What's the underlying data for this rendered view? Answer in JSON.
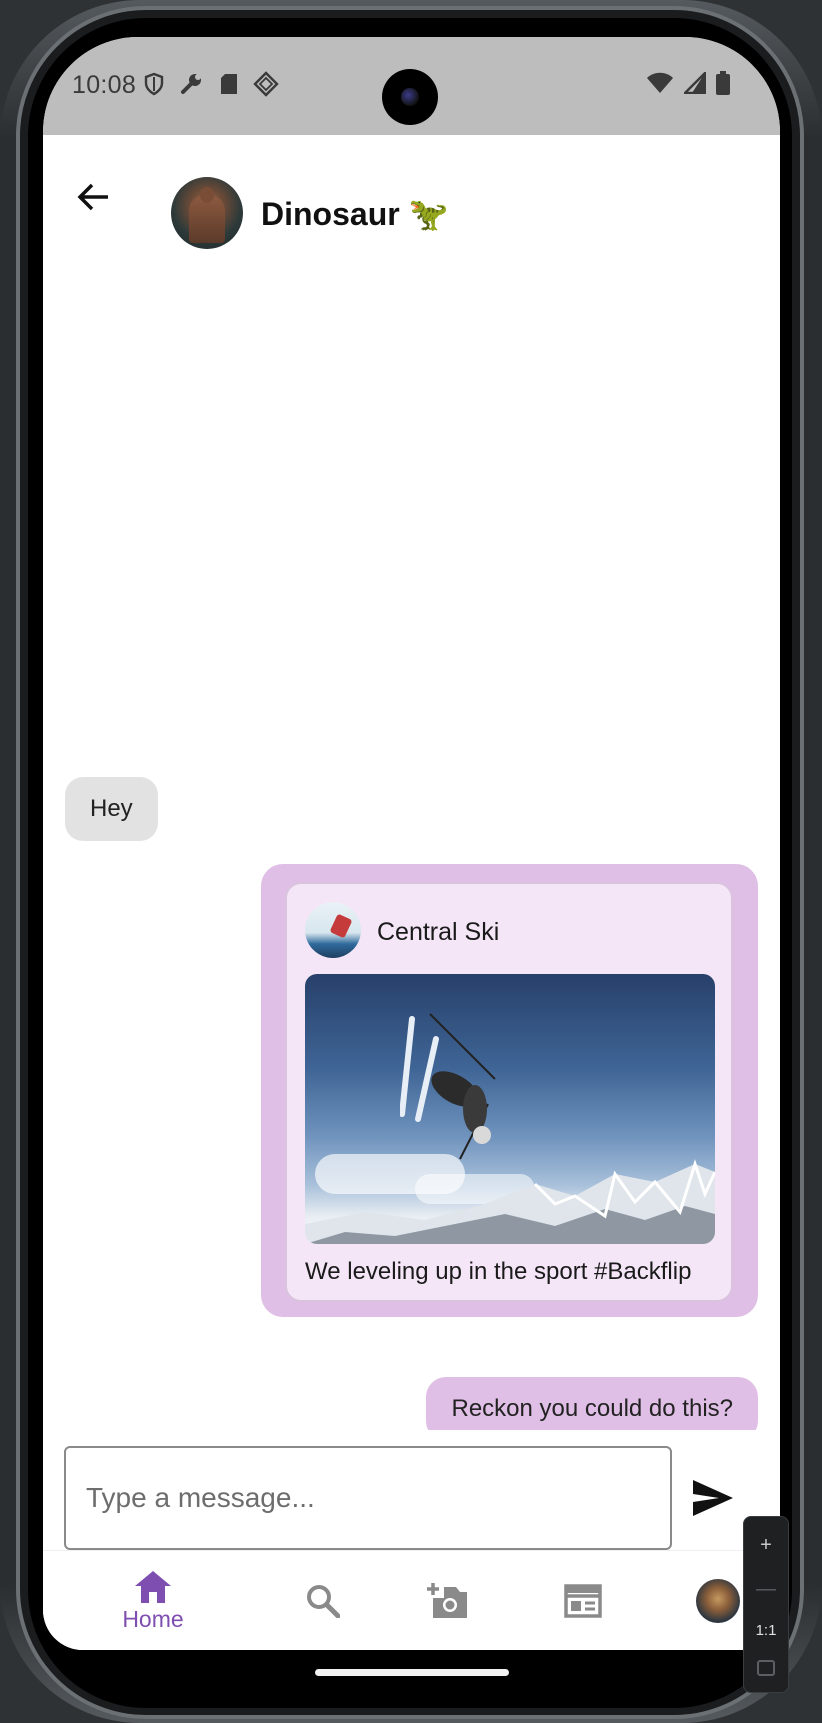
{
  "status_bar": {
    "time": "10:08",
    "left_icons": [
      "shield-icon",
      "wrench-icon",
      "sd-card-icon",
      "diamond-icon"
    ],
    "right_icons": [
      "wifi-icon",
      "cell-signal-icon",
      "battery-icon"
    ]
  },
  "header": {
    "contact_name": "Dinosaur 🦖",
    "back_icon": "arrow-left-icon"
  },
  "chat": {
    "incoming_message": "Hey",
    "shared_post": {
      "author": "Central Ski",
      "caption": "We leveling up in the sport #Backflip"
    },
    "outgoing_message": "Reckon you could do this?"
  },
  "composer": {
    "placeholder": "Type a message...",
    "value": ""
  },
  "navbar": {
    "items": [
      {
        "label": "Home",
        "icon": "home-icon",
        "active": true
      },
      {
        "label": "",
        "icon": "search-icon",
        "active": false
      },
      {
        "label": "",
        "icon": "add-photo-icon",
        "active": false
      },
      {
        "label": "",
        "icon": "feed-icon",
        "active": false
      },
      {
        "label": "",
        "icon": "profile-avatar",
        "active": false
      }
    ]
  },
  "emulator_zoom": {
    "zoom_in": "+",
    "zoom_out": "—",
    "ratio": "1:1"
  },
  "colors": {
    "accent": "#7e4fb0",
    "outgoing_bubble": "#e0bfe6",
    "incoming_bubble": "#e2e2e2",
    "card_inner": "#f4e6f7"
  }
}
